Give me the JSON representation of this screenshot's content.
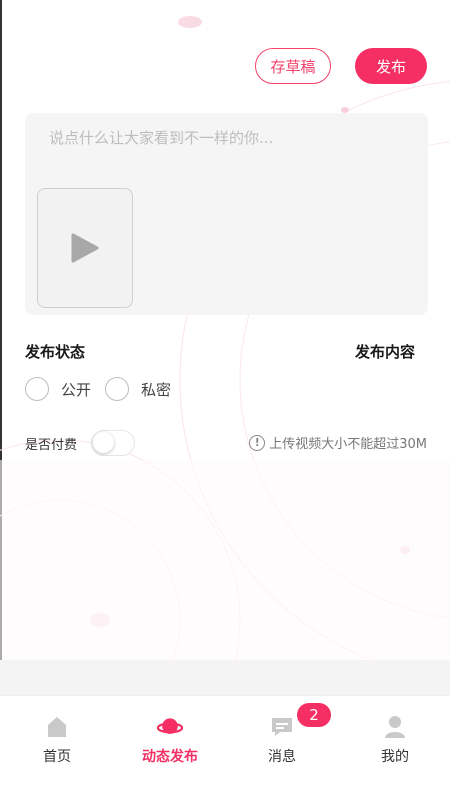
{
  "header": {
    "draft_label": "存草稿",
    "publish_label": "发布"
  },
  "compose": {
    "placeholder": "说点什么让大家看到不一样的你...",
    "video_icon": "play-icon"
  },
  "publish_status": {
    "title": "发布状态",
    "options": [
      {
        "label": "公开"
      },
      {
        "label": "私密"
      }
    ]
  },
  "publish_content": {
    "title": "发布内容"
  },
  "paid": {
    "label": "是否付费",
    "enabled": false
  },
  "upload_hint": {
    "icon": "!",
    "text": "上传视频大小不能超过30M"
  },
  "tabbar": {
    "items": [
      {
        "label": "首页",
        "icon": "home-icon"
      },
      {
        "label": "动态发布",
        "icon": "planet-icon",
        "active": true
      },
      {
        "label": "消息",
        "icon": "message-icon",
        "badge": "2"
      },
      {
        "label": "我的",
        "icon": "profile-icon"
      }
    ]
  },
  "colors": {
    "accent": "#f52f63",
    "card_bg": "#f5f5f5"
  }
}
